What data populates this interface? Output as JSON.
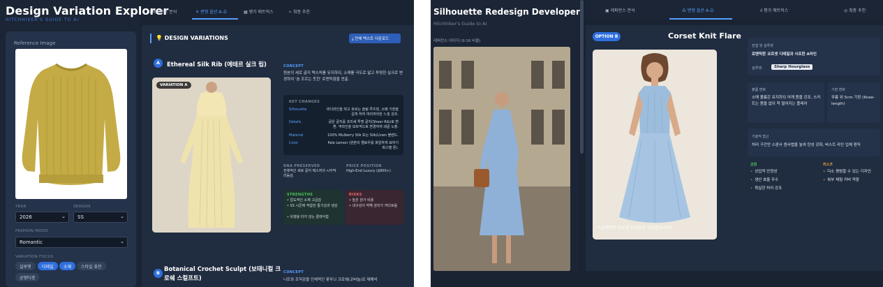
{
  "left_app": {
    "title": "Design Variation Explorer",
    "subtitle": "HITCHHIKER'S GUIDE TO AI",
    "reference_label": "Reference Image",
    "year_label": "YEAR",
    "year_value": "2026",
    "season_label": "SEASON",
    "season_value": "SS",
    "mood_label": "FASHION MOOD",
    "mood_value": "Romantic",
    "focus_label": "VARIATION FOCUS",
    "focus_chips": [
      "실루엣",
      "디테일",
      "소재",
      "스타일 퓨전",
      "균형타겟"
    ],
    "tabs": [
      "레퍼런스 분석",
      "변형 옵션 A–D",
      "평가 매트릭스",
      "최종 추천"
    ],
    "section_title": "DESIGN VARIATIONS",
    "download_label": "⤓ 전체 텍스트 다운로드",
    "variation_a": {
      "badge": "A",
      "title": "Ethereal Silk Rib (에테르 실크 립)",
      "image_tag": "VARIATION A",
      "concept_caption": "CONCEPT",
      "concept_text": "원본의 세로 골지 텍스처를 유지하되, 소재를 극도로 얇고 투명한 실크로 변경하여 '숨 조르는 듯한' 로맨틱함을 연출.",
      "key_changes_caption": "KEY CHANGES",
      "key_changes": [
        {
          "key": "Silhouette",
          "value": "바디라인을 따고 흐르는 슬림 루즈핏, 소매 기장을 길게 하여 여리여리한 느낌 강조."
        },
        {
          "key": "Details",
          "value": "굵은 골지를 초미세 투명 골지(Sheer Rib)로 변환. 넥라인을 보트넥으로 변경하여 쇄골 노출."
        },
        {
          "key": "Material",
          "value": "100% Mulberry Silk 또는 Silk/Linen 블렌드."
        },
        {
          "key": "Color",
          "value": "Pale Lemon (원본의 옐로우를 파일하게 표하기 파스텔 톤)."
        }
      ],
      "dna_caption": "DNA PRESERVED",
      "dna_text": "전체적인 세로 골지 텍스처의 시각적 리듬감.",
      "price_caption": "PRICE POSITION",
      "price_text": "High-End Luxury ($800+)",
      "strengths_caption": "STRENGTHS",
      "strengths": [
        "압도적인 소재 고급감",
        "SS 시즌에 적합한 통기성과 냉감",
        "유행을 타지 않는 클래식함"
      ],
      "risks_caption": "RISKS",
      "risks": [
        "높은 원가 비용",
        "내구성이 약해 관리가 까다로움"
      ]
    },
    "variation_b": {
      "badge": "B",
      "title_line1": "Botanical Crochet Sculpt (보태니컬 크",
      "title_line2": "로쉐 스컬프트)",
      "concept_caption": "CONCEPT",
      "concept_text": "니트와 조직감을 인체적인 꽃무늬 크로쉐(코바늘)로 재해석"
    }
  },
  "right_app": {
    "title": "Silhouette Redesign Developer",
    "subtitle": "Hitchhiker's Guide to AI",
    "reference_label": "레퍼런스 이미지 (9:16 비율)",
    "tabs": [
      "레퍼런스 분석",
      "변형 옵션 A–D",
      "평가 매트릭스",
      "최종 추천"
    ],
    "option_badge": "OPTION B",
    "variation_title": "Corset Knit Flare",
    "image_caption": "*로맨틱한 코르셋 디테일과 사프한 A라인*",
    "concept_caption": "컨셉 및 실루엣",
    "concept_text": "로맨틱한 코르셋 디테일과 사프한 A라인",
    "silhouette_label": "실루엣:",
    "silhouette_value": "Sharp Hourglass",
    "volume_caption": "볼륨 변화",
    "volume_text": "소매 볼륨은 유지하되 어깨 몸을 강조, 스커트는 몸을 없이 착 떨어지는 플레어",
    "length_caption": "기장 변화",
    "length_text": "무릎 위 5cm 기장 (Knee-length)",
    "tech_caption": "기술적 접근",
    "tech_text": "허리 구간만 스판사 원사법을 높여 탄성 강화, 바스트 라인 입체 편직",
    "strengths_caption": "강점",
    "strengths": [
      "상업적 안정성",
      "생산 효율 우수",
      "확실한 허리 강조"
    ],
    "risks_caption": "리스크",
    "risks": [
      "다소 평범할 수 있는 디자인",
      "복부 체형 커버 약함"
    ]
  }
}
